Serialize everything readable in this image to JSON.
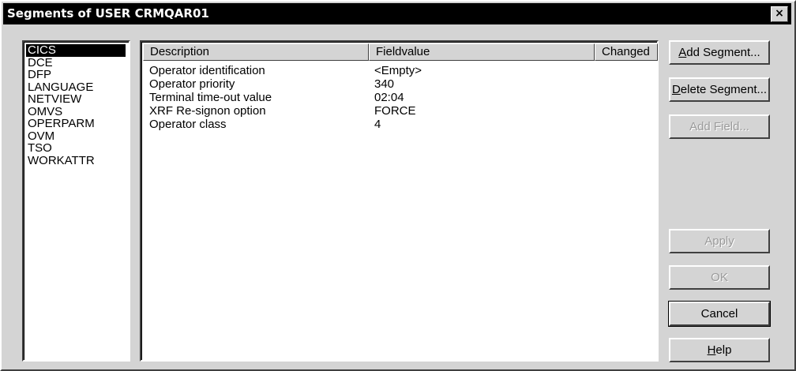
{
  "window": {
    "title": "Segments of USER CRMQAR01",
    "close_glyph": "×"
  },
  "segments": {
    "items": [
      "CICS",
      "DCE",
      "DFP",
      "LANGUAGE",
      "NETVIEW",
      "OMVS",
      "OPERPARM",
      "OVM",
      "TSO",
      "WORKATTR"
    ],
    "selected": "CICS"
  },
  "table": {
    "headers": [
      "Description",
      "Fieldvalue",
      "Changed"
    ],
    "rows": [
      {
        "description": "Operator identification",
        "fieldvalue": "<Empty>",
        "changed": ""
      },
      {
        "description": "Operator priority",
        "fieldvalue": "340",
        "changed": ""
      },
      {
        "description": "Terminal time-out value",
        "fieldvalue": "02:04",
        "changed": ""
      },
      {
        "description": "XRF Re-signon option",
        "fieldvalue": "FORCE",
        "changed": ""
      },
      {
        "description": "Operator class",
        "fieldvalue": "4",
        "changed": ""
      }
    ]
  },
  "buttons": {
    "add_segment": {
      "mnemonic": "A",
      "rest": "dd Segment..."
    },
    "delete_segment": {
      "mnemonic": "D",
      "rest": "elete Segment..."
    },
    "add_field": "Add Field...",
    "apply": "Apply",
    "ok": "OK",
    "cancel": "Cancel",
    "help": {
      "mnemonic": "H",
      "rest": "elp"
    }
  }
}
